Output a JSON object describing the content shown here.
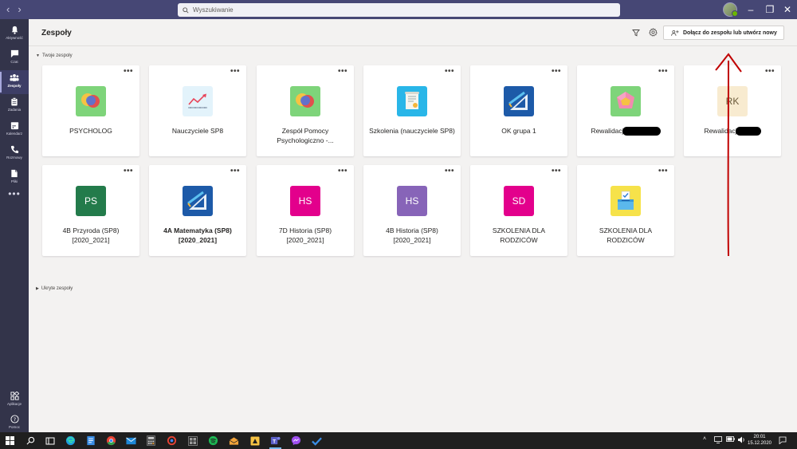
{
  "titlebar": {
    "search_placeholder": "Wyszukiwanie"
  },
  "rail": {
    "items": [
      {
        "label": "Aktywność",
        "icon": "bell-icon"
      },
      {
        "label": "Czat",
        "icon": "chat-icon"
      },
      {
        "label": "Zespoły",
        "icon": "teams-icon"
      },
      {
        "label": "Zadania",
        "icon": "assignments-icon"
      },
      {
        "label": "Kalendarz",
        "icon": "calendar-icon"
      },
      {
        "label": "Rozmowy",
        "icon": "phone-icon"
      },
      {
        "label": "Pliki",
        "icon": "files-icon"
      }
    ],
    "more": "•••",
    "bottom": [
      {
        "label": "Aplikacje",
        "icon": "apps-icon"
      },
      {
        "label": "Pomoc",
        "icon": "help-icon"
      }
    ]
  },
  "header": {
    "title": "Zespoły",
    "join_label": "Dołącz do zespołu lub utwórz nowy"
  },
  "sections": {
    "your_teams": "Twoje zespoły",
    "hidden_teams": "Ukryte zespoły"
  },
  "teams": [
    {
      "name": "PSYCHOLOG",
      "icon": "speech-bubbles-icon"
    },
    {
      "name": "Nauczyciele SP8",
      "icon": "line-chart-icon"
    },
    {
      "name": "Zespół Pomocy Psychologiczno -...",
      "icon": "speech-bubbles-icon"
    },
    {
      "name": "Szkolenia (nauczyciele SP8)",
      "icon": "certificate-icon"
    },
    {
      "name": "OK grupa 1",
      "icon": "geometry-tools-icon"
    },
    {
      "name": "Rewalidacj",
      "icon": "polyhedron-icon",
      "redacted": true
    },
    {
      "name": "Rewalidacj",
      "initials": "RK",
      "redacted": true
    },
    {
      "name": "4B Przyroda (SP8) [2020_2021]",
      "initials": "PS"
    },
    {
      "name": "4A Matematyka (SP8) [2020_2021]",
      "icon": "geometry-tools-icon",
      "bold": true
    },
    {
      "name": "7D Historia (SP8) [2020_2021]",
      "initials": "HS"
    },
    {
      "name": "4B Historia (SP8) [2020_2021]",
      "initials": "HS"
    },
    {
      "name": "SZKOLENIA DLA RODZICÓW",
      "initials": "SD"
    },
    {
      "name": "SZKOLENIA DLA RODZICÓW",
      "icon": "ballot-box-icon"
    }
  ],
  "card_more": "•••",
  "colors": {
    "titlebar": "#464775",
    "rail": "#33344a",
    "rk_tile": "#f8ebd0",
    "ps_tile": "#237b4b",
    "hs7d_tile": "#e3008c",
    "hs4b_tile": "#8764b8",
    "sd_tile": "#e3008c",
    "annotation": "#c00000"
  },
  "taskbar": {
    "time": "20:01",
    "date": "15.12.2020"
  }
}
